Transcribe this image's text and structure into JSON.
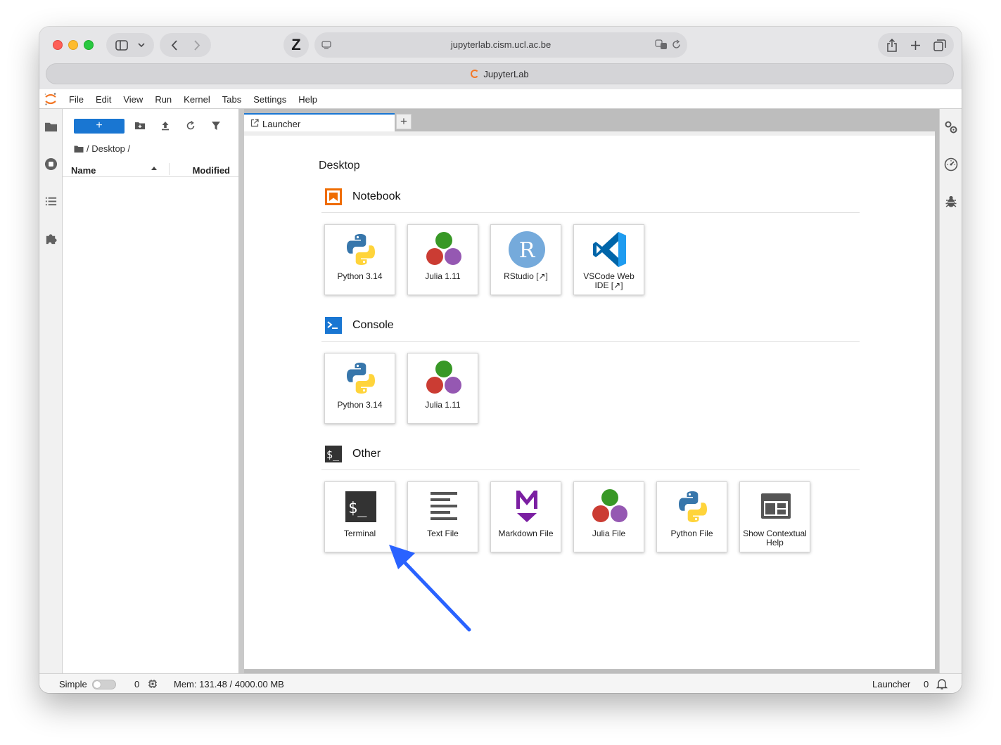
{
  "browser": {
    "url": "jupyterlab.cism.ucl.ac.be",
    "tab_title": "JupyterLab"
  },
  "menu": {
    "items": [
      "File",
      "Edit",
      "View",
      "Run",
      "Kernel",
      "Tabs",
      "Settings",
      "Help"
    ]
  },
  "filebrowser": {
    "new_label": "+",
    "breadcrumb": "/ Desktop /",
    "col_name": "Name",
    "col_modified": "Modified"
  },
  "tabs": {
    "launcher_label": "Launcher",
    "add_label": "+"
  },
  "launcher": {
    "cwd": "Desktop",
    "sections": {
      "notebook": "Notebook",
      "console": "Console",
      "other": "Other"
    },
    "cards": {
      "nb_python": "Python 3.14",
      "nb_julia": "Julia 1.11",
      "nb_rstudio": "RStudio [↗]",
      "nb_vscode": "VSCode Web IDE [↗]",
      "con_python": "Python 3.14",
      "con_julia": "Julia 1.11",
      "terminal": "Terminal",
      "textfile": "Text File",
      "markdown": "Markdown File",
      "juliafile": "Julia File",
      "pythonfile": "Python File",
      "contexthelp": "Show Contextual Help"
    }
  },
  "statusbar": {
    "mode": "Simple",
    "kernels": "0",
    "memory": "Mem: 131.48 / 4000.00 MB",
    "active": "Launcher",
    "notifications": "0"
  },
  "colors": {
    "accent": "#1976d2",
    "jupyter_orange": "#f37726",
    "annotation_arrow": "#2962ff"
  }
}
